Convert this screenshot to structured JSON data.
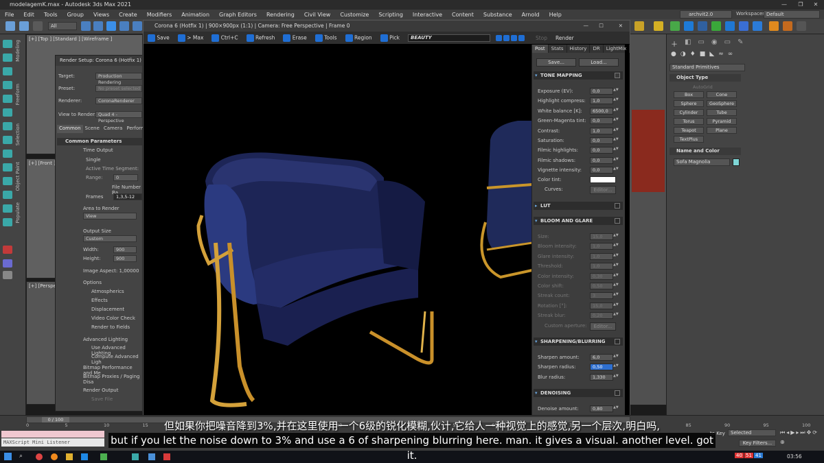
{
  "app": {
    "title": "modelagemK.max - Autodesk 3ds Max 2021",
    "account": "archvit2.0",
    "workspace_label": "Workspaces:",
    "workspace_value": "Default"
  },
  "menu": [
    "File",
    "Edit",
    "Tools",
    "Group",
    "Views",
    "Create",
    "Modifiers",
    "Animation",
    "Graph Editors",
    "Rendering",
    "Civil View",
    "Customize",
    "Scripting",
    "Interactive",
    "Content",
    "Substance",
    "Arnold",
    "Help"
  ],
  "toolbar": {
    "selection_filter": "All"
  },
  "left_tabs": [
    "Modeling",
    "Freeform",
    "Selection",
    "Object Paint",
    "Populate"
  ],
  "viewports": {
    "top": "[+] [Top ] [Standard ] [Wireframe ]",
    "front": "[+] [Front ]",
    "persp": "[+] [Perspe"
  },
  "render_setup": {
    "title": "Render Setup: Corona 6 (Hotfix 1)",
    "target_label": "Target:",
    "target_value": "Production Rendering",
    "preset_label": "Preset:",
    "preset_value": "No preset selected",
    "renderer_label": "Renderer:",
    "renderer_value": "CoronaRenderer",
    "view_label": "View to Render:",
    "view_value": "Quad 4 - Perspective",
    "tabs": [
      "Common",
      "Scene",
      "Camera",
      "Performan"
    ],
    "section": "Common Parameters",
    "time_output": "Time Output",
    "single": "Single",
    "active_time": "Active Time Segment:",
    "range_label": "Range:",
    "range_value": "0",
    "file_number": "File Number Ba",
    "frames_label": "Frames",
    "frames_value": "1,3,5-12",
    "area_label": "Area to Render",
    "area_value": "View",
    "output_size": "Output Size",
    "output_value": "Custom",
    "width_label": "Width:",
    "width_value": "900",
    "height_label": "Height:",
    "height_value": "900",
    "aspect": "Image Aspect: 1,00000",
    "options_label": "Options",
    "options": [
      "Atmospherics",
      "Effects",
      "Displacement",
      "Video Color Check",
      "Render to Fields"
    ],
    "adv_lighting": "Advanced Lighting",
    "adv_opts": [
      "Use Advanced Lighting",
      "Compute Advanced Ligh"
    ],
    "bitmap1": "Bitmap Performance and Me",
    "bitmap2": "Bitmap Proxies / Paging Disa",
    "render_output": "Render Output",
    "save_file": "Save File"
  },
  "frame_window": {
    "title": "Corona 6 (Hotfix 1) | 900×900px (1:1) | Camera: Free Perspective | Frame 0",
    "tools": [
      "Save",
      "> Max",
      "Ctrl+C",
      "Refresh",
      "Erase",
      "Tools",
      "Region",
      "Pick"
    ],
    "beauty": "BEAUTY",
    "stop": "Stop",
    "render": "Render",
    "win_min": "—",
    "win_max": "☐",
    "win_close": "✕"
  },
  "post_panel": {
    "tabs": [
      "Post",
      "Stats",
      "History",
      "DR",
      "LightMix"
    ],
    "save": "Save...",
    "load": "Load...",
    "tone_mapping": "TONE MAPPING",
    "tone_rows": [
      {
        "label": "Exposure (EV):",
        "value": "0,0"
      },
      {
        "label": "Highlight compress:",
        "value": "1,0"
      },
      {
        "label": "White balance [K]:",
        "value": "6500,0"
      },
      {
        "label": "Green-Magenta tint:",
        "value": "0,0"
      },
      {
        "label": "Contrast:",
        "value": "1,0"
      },
      {
        "label": "Saturation:",
        "value": "0,0"
      },
      {
        "label": "Filmic highlights:",
        "value": "0,0"
      },
      {
        "label": "Filmic shadows:",
        "value": "0,0"
      },
      {
        "label": "Vignette intensity:",
        "value": "0,0"
      }
    ],
    "color_tint": "Color tint:",
    "curves": "Curves:",
    "editor": "Editor...",
    "lut": "LUT",
    "bloom": "BLOOM AND GLARE",
    "bloom_rows": [
      {
        "label": "Size:",
        "value": "15,0"
      },
      {
        "label": "Bloom intensity:",
        "value": "1,0"
      },
      {
        "label": "Glare intensity:",
        "value": "1,0"
      },
      {
        "label": "Threshold:",
        "value": "1,0"
      },
      {
        "label": "Color intensity:",
        "value": "0,30"
      },
      {
        "label": "Color shift:",
        "value": "0,50"
      },
      {
        "label": "Streak count:",
        "value": "3"
      },
      {
        "label": "Rotation [°]:",
        "value": "15,0"
      },
      {
        "label": "Streak blur:",
        "value": "0,20"
      }
    ],
    "custom_aperture": "Custom aperture:",
    "sharpen": "SHARPENING/BLURRING",
    "sharpen_rows": [
      {
        "label": "Sharpen amount:",
        "value": "6,0"
      },
      {
        "label": "Sharpen radius:",
        "value": "0,50"
      },
      {
        "label": "Blur radius:",
        "value": "1,330"
      }
    ],
    "denoising": "DENOISING",
    "denoise_rows": [
      {
        "label": "Denoise amount:",
        "value": "0,80"
      }
    ]
  },
  "command_panel": {
    "dropdown": "Standard Primitives",
    "object_type": "Object Type",
    "autogrid": "AutoGrid",
    "buttons": [
      "Box",
      "Cone",
      "Sphere",
      "GeoSphere",
      "Cylinder",
      "Tube",
      "Torus",
      "Pyramid",
      "Teapot",
      "Plane",
      "TextPlus"
    ],
    "name_color": "Name and Color",
    "object_name": "Sofa Magnolia",
    "object_color": "#7fd6d6"
  },
  "timeline": {
    "frame": "0 / 100",
    "ticks": [
      "0",
      "5",
      "10",
      "15",
      "20",
      "25",
      "30",
      "35",
      "40",
      "45",
      "50",
      "55",
      "60",
      "65",
      "70",
      "75",
      "80",
      "85",
      "90",
      "95",
      "100"
    ]
  },
  "status": {
    "maxscript": "MAXScript Mini Listener",
    "selected": "Selected",
    "to_key": "to Key",
    "key_filters": "Key Filters...",
    "clock": "03:56"
  },
  "subtitles": {
    "zh": "但如果你把噪音降到3%,并在这里使用一个6级的锐化模糊,伙计,它给人一种视觉上的感觉,另一个层次,明白吗,",
    "en": "but if you let the noise down to 3% and use a 6 of sharpening blurring here. man. it gives a visual. another level. got it."
  }
}
